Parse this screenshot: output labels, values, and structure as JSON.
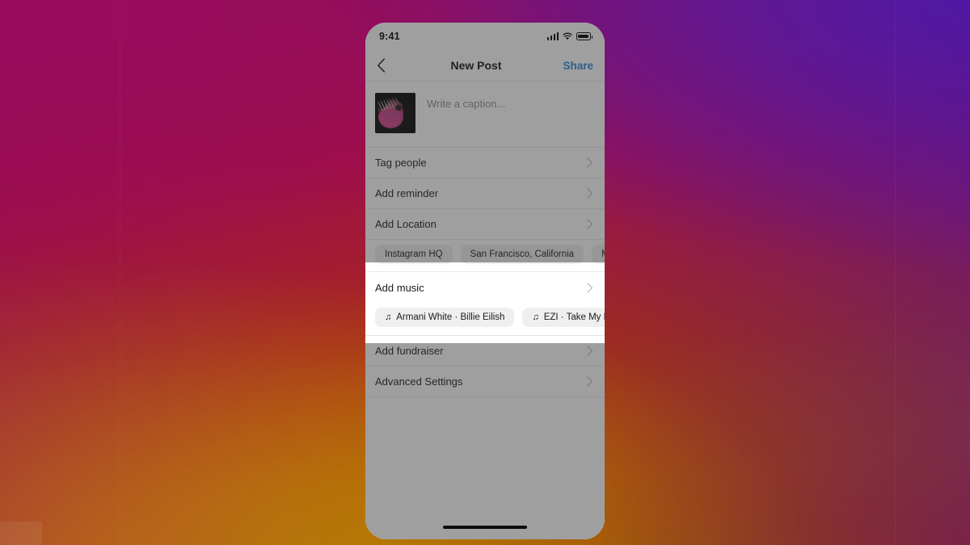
{
  "wallpaper": {
    "name": "instagram-gradient",
    "colors": [
      "#5b1fa8",
      "#9c1060",
      "#a00f45",
      "#a72c18",
      "#a85e07",
      "#9a6a05"
    ]
  },
  "phone": {
    "status_bar": {
      "time": "9:41",
      "cellular_icon": "signal-bars-icon",
      "wifi_icon": "wifi-icon",
      "battery_icon": "battery-full-icon"
    },
    "nav_bar": {
      "back_icon": "chevron-left-icon",
      "title": "New Post",
      "share_label": "Share",
      "share_color": "#2b87da"
    },
    "caption": {
      "thumbnail_alt": "pink-thistle-flower-photo",
      "placeholder": "Write a caption..."
    },
    "options": [
      {
        "label": "Tag people",
        "chevron": "chevron-right-icon"
      },
      {
        "label": "Add reminder",
        "chevron": "chevron-right-icon"
      },
      {
        "label": "Add Location",
        "chevron": "chevron-right-icon"
      }
    ],
    "location_suggestions": [
      {
        "label": "Instagram HQ"
      },
      {
        "label": "San Francisco, California"
      },
      {
        "label": "Men"
      }
    ],
    "music": {
      "label": "Add music",
      "chevron": "chevron-right-icon",
      "highlighted": true,
      "suggestions": [
        {
          "icon": "music-note-icon",
          "label": "Armani White · Billie Eilish"
        },
        {
          "icon": "music-note-icon",
          "label": "EZI · Take My Br"
        }
      ]
    },
    "options_bottom": [
      {
        "label": "Add fundraiser",
        "chevron": "chevron-right-icon"
      },
      {
        "label": "Advanced Settings",
        "chevron": "chevron-right-icon"
      }
    ],
    "home_indicator": "home-indicator-bar"
  }
}
